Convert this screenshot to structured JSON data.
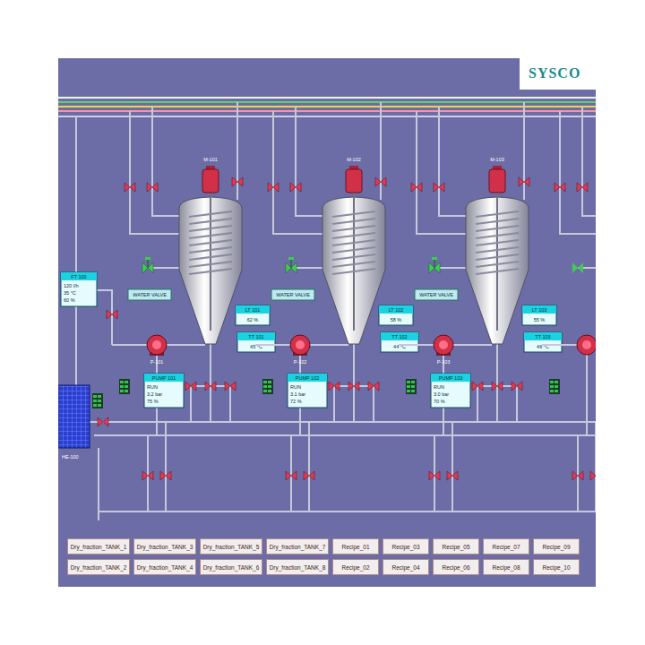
{
  "logo": {
    "text": "SYSCO"
  },
  "feed": {
    "box": {
      "title": "FT 100",
      "lines": [
        "120 l/h",
        "35 °C",
        "60 %"
      ]
    },
    "exchanger": "HE-100",
    "valves": [
      {
        "open": false
      },
      {
        "open": false
      }
    ]
  },
  "tanks": [
    {
      "motor": "M-101",
      "pump": "P-101",
      "water_valve": "WATER VALVE",
      "level": {
        "title": "LT 101",
        "value": "62 %"
      },
      "temp": {
        "title": "TT 101",
        "value": "45 °C"
      },
      "pump_box": {
        "title": "PUMP 101",
        "lines": [
          "RUN",
          "3.2 bar",
          "75 %"
        ]
      },
      "valves": [
        {
          "open": false
        },
        {
          "open": false
        },
        {
          "open": false
        },
        {
          "open": false
        },
        {
          "open": false
        },
        {
          "open": false
        },
        {
          "open": false
        },
        {
          "open": false
        }
      ]
    },
    {
      "motor": "M-102",
      "pump": "P-102",
      "water_valve": "WATER VALVE",
      "level": {
        "title": "LT 102",
        "value": "58 %"
      },
      "temp": {
        "title": "TT 102",
        "value": "44 °C"
      },
      "pump_box": {
        "title": "PUMP 102",
        "lines": [
          "RUN",
          "3.1 bar",
          "72 %"
        ]
      },
      "valves": [
        {
          "open": false
        },
        {
          "open": false
        },
        {
          "open": false
        },
        {
          "open": false
        },
        {
          "open": false
        },
        {
          "open": false
        },
        {
          "open": false
        },
        {
          "open": false
        }
      ]
    },
    {
      "motor": "M-103",
      "pump": "P-103",
      "water_valve": "WATER VALVE",
      "level": {
        "title": "LT 103",
        "value": "55 %"
      },
      "temp": {
        "title": "TT 103",
        "value": "46 °C"
      },
      "pump_box": {
        "title": "PUMP 103",
        "lines": [
          "RUN",
          "3.0 bar",
          "70 %"
        ]
      },
      "valves": [
        {
          "open": false
        },
        {
          "open": false
        },
        {
          "open": false
        },
        {
          "open": false
        },
        {
          "open": false
        },
        {
          "open": false
        },
        {
          "open": false
        },
        {
          "open": false
        }
      ]
    }
  ],
  "edge_group": {
    "valves": [
      {
        "open": false
      },
      {
        "open": false
      },
      {
        "open": false
      },
      {
        "open": false
      }
    ]
  },
  "buttons": [
    [
      "Dry_fraction_TANK_1",
      "Dry_fraction_TANK_3",
      "Dry_fraction_TANK_5",
      "Dry_fraction_TANK_7",
      "Recipe_01",
      "Recipe_03",
      "Recipe_05",
      "Recipe_07",
      "Recipe_09"
    ],
    [
      "Dry_fraction_TANK_2",
      "Dry_fraction_TANK_4",
      "Dry_fraction_TANK_6",
      "Dry_fraction_TANK_8",
      "Recipe_02",
      "Recipe_04",
      "Recipe_06",
      "Recipe_08",
      "Recipe_10"
    ]
  ]
}
